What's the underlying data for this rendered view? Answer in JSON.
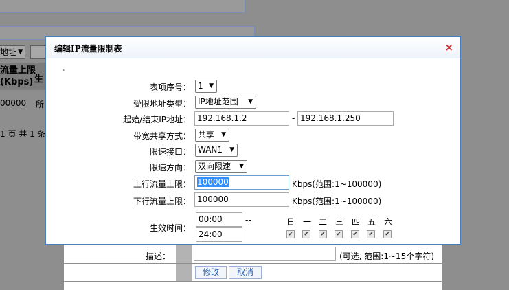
{
  "background": {
    "select_value": "地址",
    "table_header": [
      "流量上限",
      "(Kbps)"
    ],
    "table_header_next": "生",
    "row_value": "00000",
    "row_value_next": "所",
    "pager_text": "1 页 共 1 条"
  },
  "modal": {
    "title": "编辑IP流量限制表",
    "close_icon": "×"
  },
  "form": {
    "index_label": "表项序号：",
    "index_value": "1",
    "addr_type_label": "受限地址类型：",
    "addr_type_value": "IP地址范围",
    "ip_range_label": "起始/结束IP地址：",
    "ip_start": "192.168.1.2",
    "ip_dash": "-",
    "ip_end": "192.168.1.250",
    "share_label": "带宽共享方式：",
    "share_value": "共享",
    "iface_label": "限速接口：",
    "iface_value": "WAN1",
    "direction_label": "限速方向：",
    "direction_value": "双向限速",
    "up_label": "上行流量上限：",
    "up_value": "100000",
    "up_hint": "Kbps(范围:1~100000)",
    "down_label": "下行流量上限：",
    "down_value": "100000",
    "down_hint": "Kbps(范围:1~100000)",
    "time_label": "生效时间：",
    "time_start": "00:00",
    "time_sep": "--",
    "time_end": "24:00",
    "days": [
      "日",
      "一",
      "二",
      "三",
      "四",
      "五",
      "六"
    ],
    "days_checked": [
      true,
      true,
      true,
      true,
      true,
      true,
      true
    ],
    "desc_label": "描述：",
    "desc_value": "",
    "desc_hint": "(可选, 范围:1~15个字符)",
    "modify_button": "修改",
    "cancel_button": "取消"
  }
}
